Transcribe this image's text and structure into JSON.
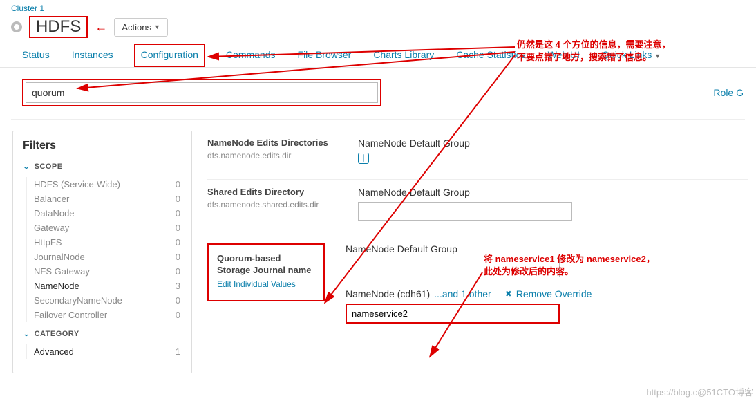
{
  "cluster_link": "Cluster 1",
  "service_title": "HDFS",
  "actions_label": "Actions",
  "tabs": [
    "Status",
    "Instances",
    "Configuration",
    "Commands",
    "File Browser",
    "Charts Library",
    "Cache Statistics",
    "Web UI",
    "Quick Links"
  ],
  "role_link": "Role G",
  "search_value": "quorum",
  "filters": {
    "title": "Filters",
    "scope_label": "SCOPE",
    "category_label": "CATEGORY",
    "scope": [
      {
        "label": "HDFS (Service-Wide)",
        "count": "0"
      },
      {
        "label": "Balancer",
        "count": "0"
      },
      {
        "label": "DataNode",
        "count": "0"
      },
      {
        "label": "Gateway",
        "count": "0"
      },
      {
        "label": "HttpFS",
        "count": "0"
      },
      {
        "label": "JournalNode",
        "count": "0"
      },
      {
        "label": "NFS Gateway",
        "count": "0"
      },
      {
        "label": "NameNode",
        "count": "3",
        "selected": true
      },
      {
        "label": "SecondaryNameNode",
        "count": "0"
      },
      {
        "label": "Failover Controller",
        "count": "0"
      }
    ],
    "category": [
      {
        "label": "Advanced",
        "count": "1"
      }
    ]
  },
  "config": [
    {
      "title": "NameNode Edits Directories",
      "sub": "dfs.namenode.edits.dir",
      "group": "NameNode Default Group",
      "add": true
    },
    {
      "title": "Shared Edits Directory",
      "sub": "dfs.namenode.shared.edits.dir",
      "group": "NameNode Default Group",
      "input": true
    },
    {
      "title": "Quorum-based Storage Journal name",
      "link": "Edit Individual Values",
      "group": "NameNode Default Group",
      "input": true,
      "override": {
        "name": "NameNode (cdh61)",
        "more": "...and 1 other",
        "remove": "Remove Override",
        "value": "nameservice2"
      },
      "boxed": true
    }
  ],
  "notes": {
    "top": "仍然是这 4 个方位的信息，需要注意，\n不要点错了地方，搜索错了信息。",
    "mid": "将 nameservice1 修改为 nameservice2，\n此处为修改后的内容。"
  },
  "watermark": "https://blog.c@51CTO博客"
}
